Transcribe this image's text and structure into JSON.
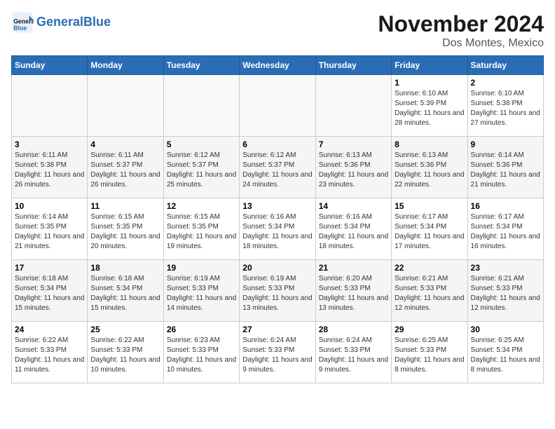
{
  "logo": {
    "general": "General",
    "blue": "Blue"
  },
  "title": "November 2024",
  "location": "Dos Montes, Mexico",
  "weekdays": [
    "Sunday",
    "Monday",
    "Tuesday",
    "Wednesday",
    "Thursday",
    "Friday",
    "Saturday"
  ],
  "weeks": [
    [
      {
        "day": "",
        "info": ""
      },
      {
        "day": "",
        "info": ""
      },
      {
        "day": "",
        "info": ""
      },
      {
        "day": "",
        "info": ""
      },
      {
        "day": "",
        "info": ""
      },
      {
        "day": "1",
        "info": "Sunrise: 6:10 AM\nSunset: 5:39 PM\nDaylight: 11 hours and 28 minutes."
      },
      {
        "day": "2",
        "info": "Sunrise: 6:10 AM\nSunset: 5:38 PM\nDaylight: 11 hours and 27 minutes."
      }
    ],
    [
      {
        "day": "3",
        "info": "Sunrise: 6:11 AM\nSunset: 5:38 PM\nDaylight: 11 hours and 26 minutes."
      },
      {
        "day": "4",
        "info": "Sunrise: 6:11 AM\nSunset: 5:37 PM\nDaylight: 11 hours and 26 minutes."
      },
      {
        "day": "5",
        "info": "Sunrise: 6:12 AM\nSunset: 5:37 PM\nDaylight: 11 hours and 25 minutes."
      },
      {
        "day": "6",
        "info": "Sunrise: 6:12 AM\nSunset: 5:37 PM\nDaylight: 11 hours and 24 minutes."
      },
      {
        "day": "7",
        "info": "Sunrise: 6:13 AM\nSunset: 5:36 PM\nDaylight: 11 hours and 23 minutes."
      },
      {
        "day": "8",
        "info": "Sunrise: 6:13 AM\nSunset: 5:36 PM\nDaylight: 11 hours and 22 minutes."
      },
      {
        "day": "9",
        "info": "Sunrise: 6:14 AM\nSunset: 5:36 PM\nDaylight: 11 hours and 21 minutes."
      }
    ],
    [
      {
        "day": "10",
        "info": "Sunrise: 6:14 AM\nSunset: 5:35 PM\nDaylight: 11 hours and 21 minutes."
      },
      {
        "day": "11",
        "info": "Sunrise: 6:15 AM\nSunset: 5:35 PM\nDaylight: 11 hours and 20 minutes."
      },
      {
        "day": "12",
        "info": "Sunrise: 6:15 AM\nSunset: 5:35 PM\nDaylight: 11 hours and 19 minutes."
      },
      {
        "day": "13",
        "info": "Sunrise: 6:16 AM\nSunset: 5:34 PM\nDaylight: 11 hours and 18 minutes."
      },
      {
        "day": "14",
        "info": "Sunrise: 6:16 AM\nSunset: 5:34 PM\nDaylight: 11 hours and 18 minutes."
      },
      {
        "day": "15",
        "info": "Sunrise: 6:17 AM\nSunset: 5:34 PM\nDaylight: 11 hours and 17 minutes."
      },
      {
        "day": "16",
        "info": "Sunrise: 6:17 AM\nSunset: 5:34 PM\nDaylight: 11 hours and 16 minutes."
      }
    ],
    [
      {
        "day": "17",
        "info": "Sunrise: 6:18 AM\nSunset: 5:34 PM\nDaylight: 11 hours and 15 minutes."
      },
      {
        "day": "18",
        "info": "Sunrise: 6:18 AM\nSunset: 5:34 PM\nDaylight: 11 hours and 15 minutes."
      },
      {
        "day": "19",
        "info": "Sunrise: 6:19 AM\nSunset: 5:33 PM\nDaylight: 11 hours and 14 minutes."
      },
      {
        "day": "20",
        "info": "Sunrise: 6:19 AM\nSunset: 5:33 PM\nDaylight: 11 hours and 13 minutes."
      },
      {
        "day": "21",
        "info": "Sunrise: 6:20 AM\nSunset: 5:33 PM\nDaylight: 11 hours and 13 minutes."
      },
      {
        "day": "22",
        "info": "Sunrise: 6:21 AM\nSunset: 5:33 PM\nDaylight: 11 hours and 12 minutes."
      },
      {
        "day": "23",
        "info": "Sunrise: 6:21 AM\nSunset: 5:33 PM\nDaylight: 11 hours and 12 minutes."
      }
    ],
    [
      {
        "day": "24",
        "info": "Sunrise: 6:22 AM\nSunset: 5:33 PM\nDaylight: 11 hours and 11 minutes."
      },
      {
        "day": "25",
        "info": "Sunrise: 6:22 AM\nSunset: 5:33 PM\nDaylight: 11 hours and 10 minutes."
      },
      {
        "day": "26",
        "info": "Sunrise: 6:23 AM\nSunset: 5:33 PM\nDaylight: 11 hours and 10 minutes."
      },
      {
        "day": "27",
        "info": "Sunrise: 6:24 AM\nSunset: 5:33 PM\nDaylight: 11 hours and 9 minutes."
      },
      {
        "day": "28",
        "info": "Sunrise: 6:24 AM\nSunset: 5:33 PM\nDaylight: 11 hours and 9 minutes."
      },
      {
        "day": "29",
        "info": "Sunrise: 6:25 AM\nSunset: 5:33 PM\nDaylight: 11 hours and 8 minutes."
      },
      {
        "day": "30",
        "info": "Sunrise: 6:25 AM\nSunset: 5:34 PM\nDaylight: 11 hours and 8 minutes."
      }
    ]
  ]
}
